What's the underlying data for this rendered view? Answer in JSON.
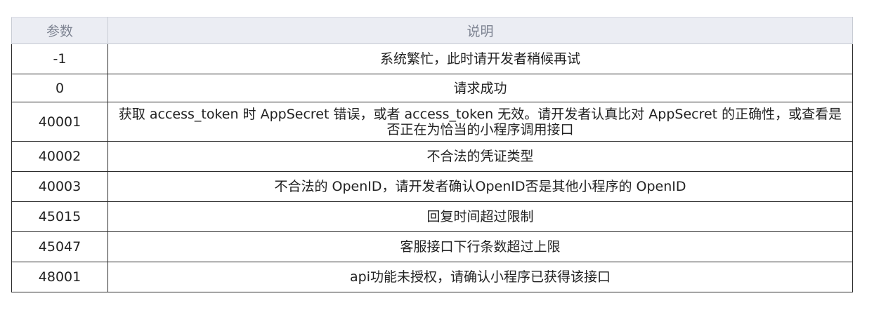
{
  "table": {
    "headers": [
      "参数",
      "说明"
    ],
    "rows": [
      {
        "code": "-1",
        "desc": "系统繁忙，此时请开发者稍候再试"
      },
      {
        "code": "0",
        "desc": "请求成功"
      },
      {
        "code": "40001",
        "desc": "获取 access_token 时 AppSecret 错误，或者 access_token 无效。请开发者认真比对 AppSecret 的正确性，或查看是否正在为恰当的小程序调用接口"
      },
      {
        "code": "40002",
        "desc": "不合法的凭证类型"
      },
      {
        "code": "40003",
        "desc": "不合法的 OpenID，请开发者确认OpenID否是其他小程序的 OpenID"
      },
      {
        "code": "45015",
        "desc": "回复时间超过限制"
      },
      {
        "code": "45047",
        "desc": "客服接口下行条数超过上限"
      },
      {
        "code": "48001",
        "desc": "api功能未授权，请确认小程序已获得该接口"
      }
    ]
  }
}
